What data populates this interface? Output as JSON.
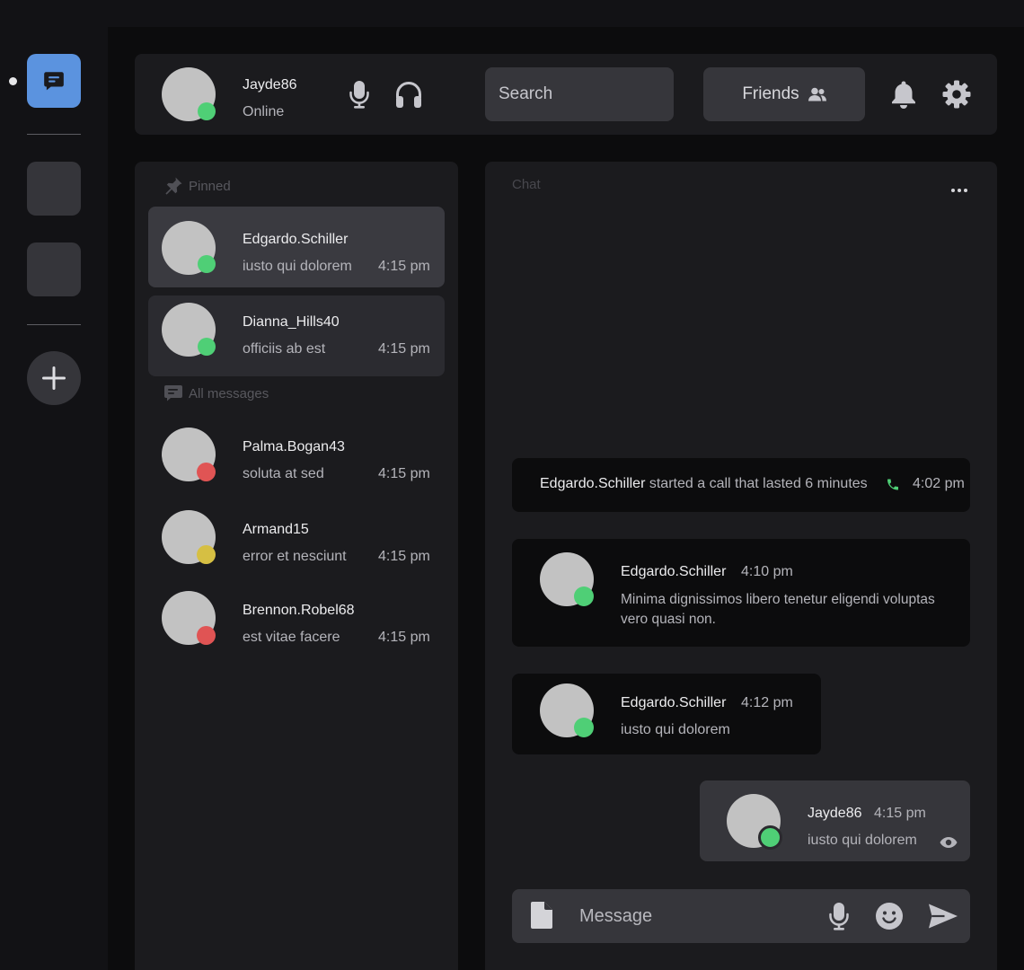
{
  "user": {
    "name": "Jayde86",
    "status_text": "Online",
    "status": "online"
  },
  "search": {
    "placeholder": "Search"
  },
  "friends": {
    "label": "Friends"
  },
  "sidebar": {
    "pinned_label": "Pinned",
    "all_label": "All messages",
    "pinned": [
      {
        "name": "Edgardo.Schiller",
        "preview": "iusto qui dolorem",
        "time": "4:15 pm",
        "status": "online"
      },
      {
        "name": "Dianna_Hills40",
        "preview": "officiis ab est",
        "time": "4:15 pm",
        "status": "online"
      }
    ],
    "messages": [
      {
        "name": "Palma.Bogan43",
        "preview": "soluta at sed",
        "time": "4:15 pm",
        "status": "busy"
      },
      {
        "name": "Armand15",
        "preview": "error et nesciunt",
        "time": "4:15 pm",
        "status": "away"
      },
      {
        "name": "Brennon.Robel68",
        "preview": "est vitae facere",
        "time": "4:15 pm",
        "status": "busy"
      }
    ]
  },
  "chat": {
    "label": "Chat",
    "call": {
      "name": "Edgardo.Schiller",
      "text": "started a call that lasted 6 minutes",
      "time": "4:02 pm"
    },
    "messages": [
      {
        "name": "Edgardo.Schiller",
        "time": "4:10 pm",
        "text": "Minima dignissimos libero tenetur eligendi voluptas vero quasi non.",
        "status": "online"
      },
      {
        "name": "Edgardo.Schiller",
        "time": "4:12 pm",
        "text": "iusto qui dolorem",
        "status": "online"
      }
    ],
    "own_message": {
      "name": "Jayde86",
      "time": "4:15 pm",
      "text": "iusto qui dolorem",
      "status": "online"
    }
  },
  "composer": {
    "placeholder": "Message"
  },
  "colors": {
    "accent": "#5b93df",
    "online": "#4fcf76",
    "busy": "#e05454",
    "away": "#d6bf43"
  }
}
